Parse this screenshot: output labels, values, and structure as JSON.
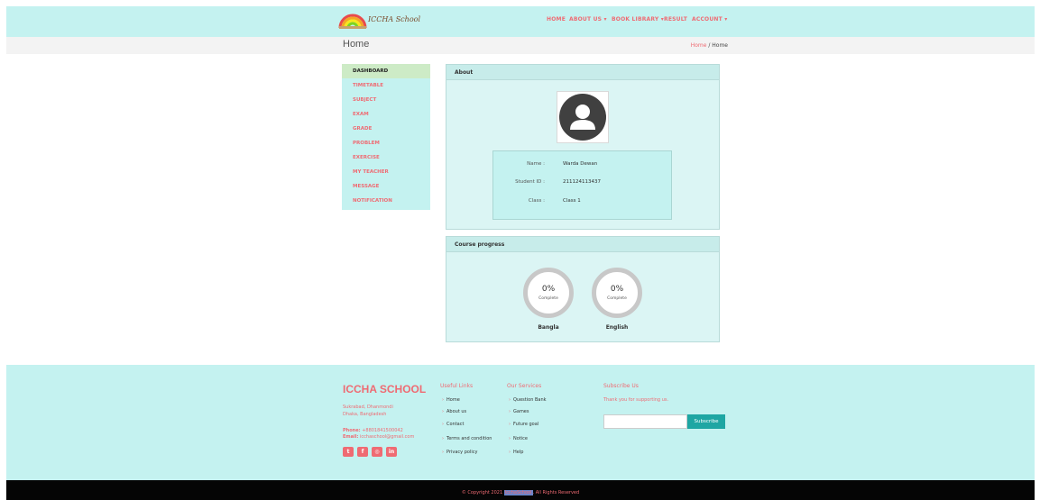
{
  "header": {
    "logo_text": "ICCHA School",
    "nav": [
      {
        "label": "HOME"
      },
      {
        "label": "ABOUT US ▾"
      },
      {
        "label": "BOOK LIBRARY ▾"
      },
      {
        "label": "RESULT"
      },
      {
        "label": "ACCOUNT ▾"
      }
    ]
  },
  "breadcrumb": {
    "title": "Home",
    "link": "Home",
    "separator": " / ",
    "current": "Home"
  },
  "sidebar": {
    "items": [
      {
        "label": "DASHBOARD"
      },
      {
        "label": "TIMETABLE"
      },
      {
        "label": "SUBJECT"
      },
      {
        "label": "EXAM"
      },
      {
        "label": "GRADE"
      },
      {
        "label": "PROBLEM"
      },
      {
        "label": "EXERCISE"
      },
      {
        "label": "MY TEACHER"
      },
      {
        "label": "MESSAGE"
      },
      {
        "label": "NOTIFICATION"
      }
    ]
  },
  "about": {
    "title": "About",
    "name_label": "Name :",
    "name": "Warda Dewan",
    "id_label": "Student ID :",
    "student_id": "211124113437",
    "class_label": "Class :",
    "class": "Class 1"
  },
  "progress": {
    "title": "Course progress",
    "courses": [
      {
        "pct": "0%",
        "sub": "Complete",
        "name": "Bangla",
        "value": 0
      },
      {
        "pct": "0%",
        "sub": "Complete",
        "name": "English",
        "value": 0
      }
    ]
  },
  "footer": {
    "brand": "ICCHA SCHOOL",
    "address1": "Sukrabad, Dhanmondi",
    "address2": "Dhaka, Bangladesh",
    "phone_label": "Phone:",
    "phone": "+8801841500042",
    "email_label": "Email:",
    "email": "icchaschool@gmail.com",
    "useful_links_title": "Useful Links",
    "useful_links": [
      "Home",
      "About us",
      "Contact",
      "Terms and condition",
      "Privacy policy"
    ],
    "services_title": "Our Services",
    "services": [
      "Question Bank",
      "Games",
      "Future goal",
      "Notice",
      "Help"
    ],
    "subscribe_title": "Subscribe Us",
    "subscribe_text": "Thank you for supporting us.",
    "subscribe_button": "Subscribe",
    "copyright_pre": "© Copyright 2021 ",
    "copyright_brand": "IcchaSchool",
    "copyright_post": ". All Rights Reserved"
  },
  "colors": {
    "accent": "#ef6b73",
    "mint": "#c4f2f0",
    "button": "#1ea6a3"
  }
}
